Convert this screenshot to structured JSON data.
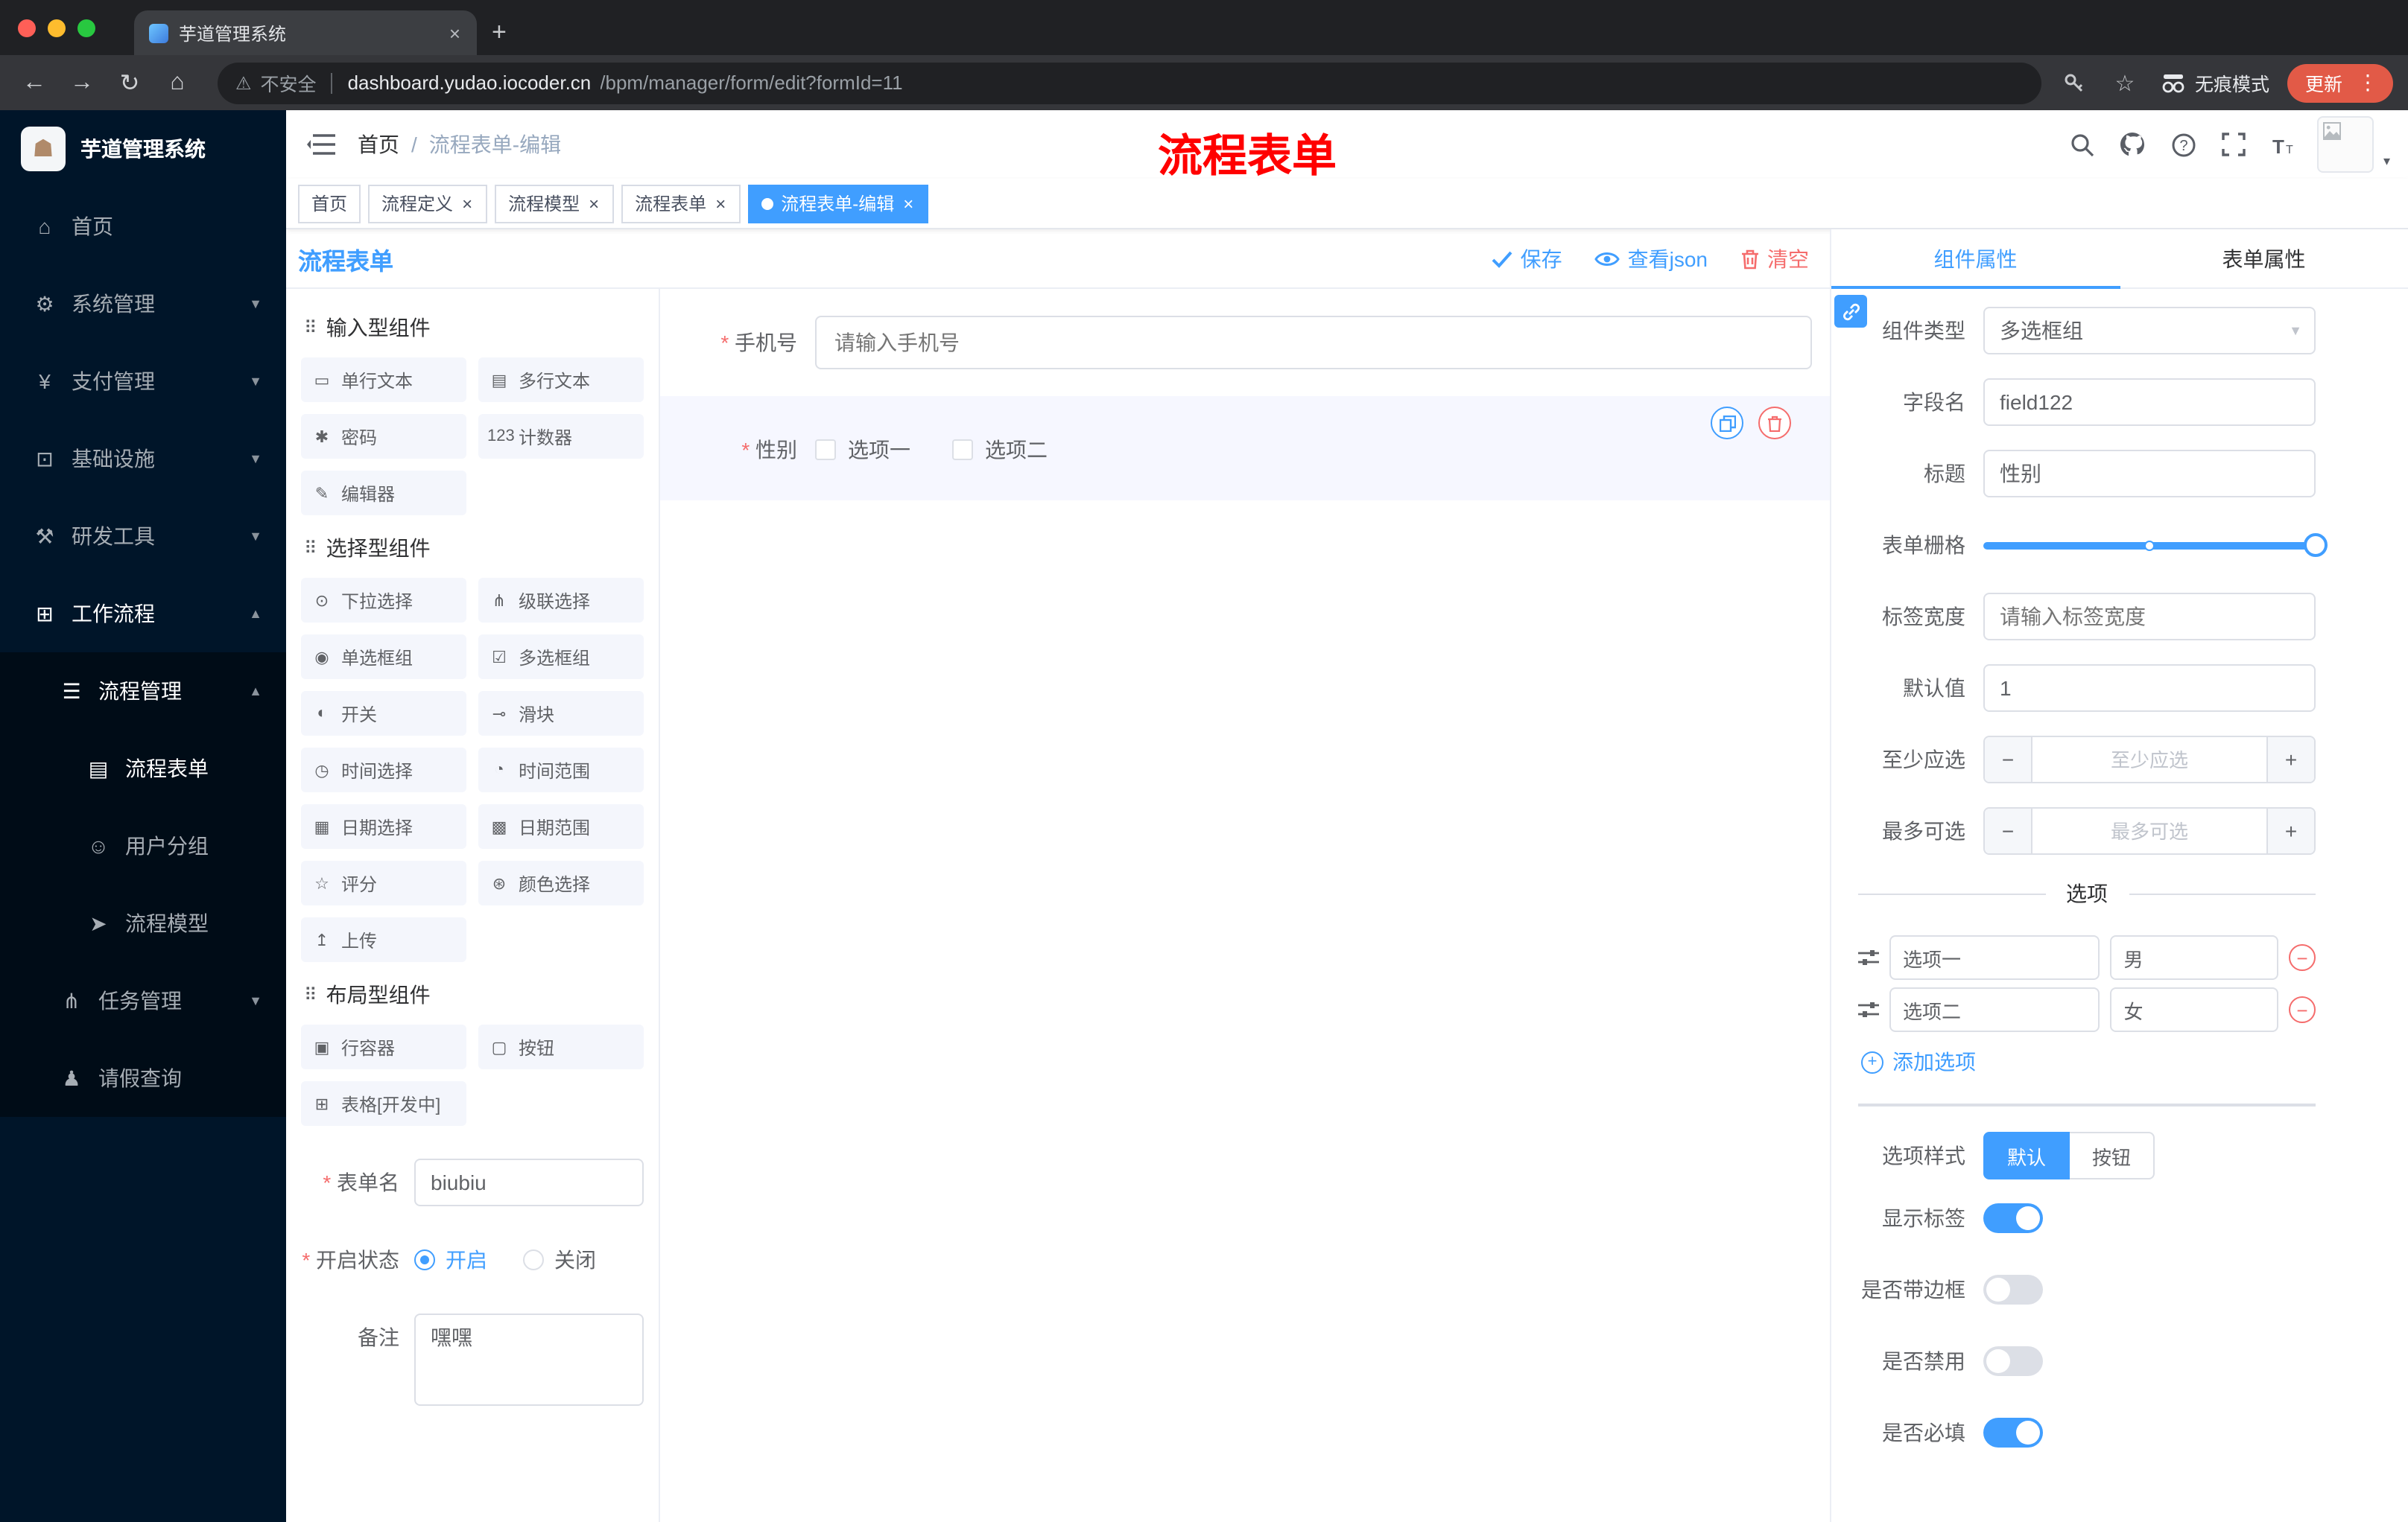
{
  "colors": {
    "accent": "#409eff",
    "danger": "#f56c6c",
    "sidebar": "#001529",
    "submenu": "#000c17",
    "update_pill": "#e25a47",
    "annotation_red": "#ff0000"
  },
  "browser": {
    "tab": {
      "title": "芋道管理系统"
    },
    "nav": {
      "security_label": "不安全",
      "host": "dashboard.yudao.iocoder.cn",
      "path": "/bpm/manager/form/edit?formId=11",
      "incognito_label": "无痕模式",
      "update_label": "更新"
    }
  },
  "sidebar": {
    "logo_title": "芋道管理系统",
    "logo_glyph": "☗",
    "icon_glyphs": {
      "home": "⌂",
      "gear": "⚙",
      "yen": "¥",
      "infra": "⊡",
      "tools": "⚒",
      "workflow": "⊞",
      "list": "☰",
      "form": "▤",
      "users": "☺",
      "send": "➤",
      "tasks": "⋔",
      "person": "♟"
    },
    "menu": [
      {
        "label": "首页",
        "icon": "home",
        "level": 1
      },
      {
        "label": "系统管理",
        "icon": "gear",
        "level": 1,
        "arrow": "down"
      },
      {
        "label": "支付管理",
        "icon": "yen",
        "level": 1,
        "arrow": "down"
      },
      {
        "label": "基础设施",
        "icon": "infra",
        "level": 1,
        "arrow": "down"
      },
      {
        "label": "研发工具",
        "icon": "tools",
        "level": 1,
        "arrow": "down"
      },
      {
        "label": "工作流程",
        "icon": "workflow",
        "level": 1,
        "arrow": "up",
        "open": true
      },
      {
        "label": "流程管理",
        "icon": "list",
        "level": 2,
        "arrow": "up",
        "open": true
      },
      {
        "label": "流程表单",
        "icon": "form",
        "level": 3,
        "active": true
      },
      {
        "label": "用户分组",
        "icon": "users",
        "level": 3
      },
      {
        "label": "流程模型",
        "icon": "send",
        "level": 3
      },
      {
        "label": "任务管理",
        "icon": "tasks",
        "level": 2,
        "arrow": "down"
      },
      {
        "label": "请假查询",
        "icon": "person",
        "level": 2
      }
    ]
  },
  "header": {
    "breadcrumb_home": "首页",
    "breadcrumb_separator": "/",
    "breadcrumb_current": "流程表单-编辑"
  },
  "annotation": {
    "text": "流程表单"
  },
  "tags": [
    {
      "label": "首页",
      "closable": false,
      "active": false
    },
    {
      "label": "流程定义",
      "closable": true,
      "active": false
    },
    {
      "label": "流程模型",
      "closable": true,
      "active": false
    },
    {
      "label": "流程表单",
      "closable": true,
      "active": false
    },
    {
      "label": "流程表单-编辑",
      "closable": true,
      "active": true
    }
  ],
  "designer": {
    "title": "流程表单",
    "actions": {
      "save": "保存",
      "view_json": "查看json",
      "clear": "清空"
    },
    "icon_glyphs": {
      "input-single": "▭",
      "input-multi": "▤",
      "password": "✱",
      "counter": "123",
      "editor": "✎",
      "select": "⊙",
      "cascader": "⋔",
      "radio-group": "◉",
      "checkbox-group": "☑",
      "switch": "◐",
      "slider": "⊸",
      "time": "◷",
      "time-range": "◔",
      "date": "▦",
      "date-range": "▩",
      "rate": "☆",
      "color": "⊛",
      "upload": "↥",
      "row": "▣",
      "button": "▢",
      "table": "⊞",
      "group-drag": "⠿"
    },
    "component_groups": [
      {
        "title": "输入型组件",
        "items": [
          {
            "label": "单行文本",
            "icon": "input-single"
          },
          {
            "label": "多行文本",
            "icon": "input-multi"
          },
          {
            "label": "密码",
            "icon": "password"
          },
          {
            "label": "计数器",
            "icon": "counter"
          },
          {
            "label": "编辑器",
            "icon": "editor"
          }
        ]
      },
      {
        "title": "选择型组件",
        "items": [
          {
            "label": "下拉选择",
            "icon": "select"
          },
          {
            "label": "级联选择",
            "icon": "cascader"
          },
          {
            "label": "单选框组",
            "icon": "radio-group"
          },
          {
            "label": "多选框组",
            "icon": "checkbox-group"
          },
          {
            "label": "开关",
            "icon": "switch"
          },
          {
            "label": "滑块",
            "icon": "slider"
          },
          {
            "label": "时间选择",
            "icon": "time"
          },
          {
            "label": "时间范围",
            "icon": "time-range"
          },
          {
            "label": "日期选择",
            "icon": "date"
          },
          {
            "label": "日期范围",
            "icon": "date-range"
          },
          {
            "label": "评分",
            "icon": "rate"
          },
          {
            "label": "颜色选择",
            "icon": "color"
          },
          {
            "label": "上传",
            "icon": "upload"
          }
        ]
      },
      {
        "title": "布局型组件",
        "items": [
          {
            "label": "行容器",
            "icon": "row"
          },
          {
            "label": "按钮",
            "icon": "button"
          },
          {
            "label": "表格[开发中]",
            "icon": "table"
          }
        ]
      }
    ],
    "meta": {
      "form_name": {
        "label": "表单名",
        "value": "biubiu"
      },
      "status": {
        "label": "开启状态",
        "options": [
          {
            "label": "开启",
            "selected": true
          },
          {
            "label": "关闭",
            "selected": false
          }
        ]
      },
      "remark": {
        "label": "备注",
        "value": "嘿嘿"
      }
    },
    "canvas": {
      "phone": {
        "label": "手机号",
        "placeholder": "请输入手机号"
      },
      "gender": {
        "label": "性别",
        "options": [
          "选项一",
          "选项二"
        ]
      }
    },
    "properties": {
      "tabs": [
        {
          "label": "组件属性",
          "active": true
        },
        {
          "label": "表单属性",
          "active": false
        }
      ],
      "component_type": {
        "label": "组件类型",
        "value": "多选框组"
      },
      "field_name": {
        "label": "字段名",
        "value": "field122"
      },
      "title": {
        "label": "标题",
        "value": "性别"
      },
      "grid": {
        "label": "表单栅格"
      },
      "label_width": {
        "label": "标签宽度",
        "placeholder": "请输入标签宽度"
      },
      "default_value": {
        "label": "默认值",
        "value": "1"
      },
      "min_select": {
        "label": "至少应选",
        "placeholder": "至少应选"
      },
      "max_select": {
        "label": "最多可选",
        "placeholder": "最多可选"
      },
      "options_divider": "选项",
      "options": [
        {
          "label": "选项一",
          "value": "男"
        },
        {
          "label": "选项二",
          "value": "女"
        }
      ],
      "add_option_label": "添加选项",
      "option_style": {
        "label": "选项样式",
        "options": [
          "默认",
          "按钮"
        ],
        "selected": "默认"
      },
      "switches": [
        {
          "label": "显示标签",
          "on": true
        },
        {
          "label": "是否带边框",
          "on": false
        },
        {
          "label": "是否禁用",
          "on": false
        },
        {
          "label": "是否必填",
          "on": true
        }
      ]
    }
  }
}
